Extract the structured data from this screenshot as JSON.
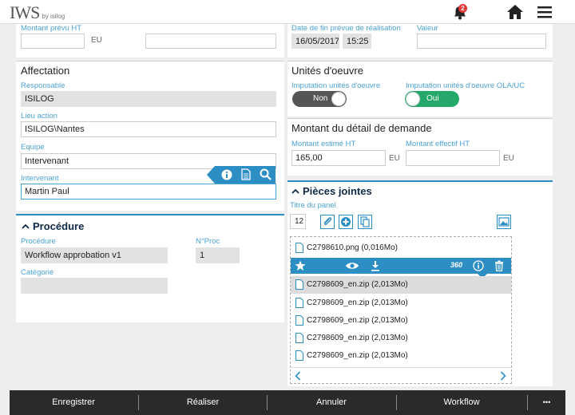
{
  "header": {
    "logo_main": "IWS",
    "logo_sub": "by isilog",
    "notification_count": "2"
  },
  "montant_prevu": {
    "label": "Montant prévu HT",
    "value": "",
    "unit": "EU"
  },
  "date_fin": {
    "label": "Date de fin prévue de réalisation",
    "date": "16/05/2017",
    "time": "15:25",
    "valeur_label": "Valeur",
    "valeur_value": ""
  },
  "affectation": {
    "title": "Affectation",
    "responsable_label": "Responsable",
    "responsable_value": "ISILOG",
    "lieu_label": "Lieu action",
    "lieu_value": "ISILOG\\Nantes",
    "equipe_label": "Equipe",
    "equipe_value": "Intervenant",
    "intervenant_label": "Intervenant",
    "intervenant_value": "Martin Paul"
  },
  "unites": {
    "title": "Unités d'oeuvre",
    "imputation_label": "Imputation unités d'oeuvre",
    "imputation_state": "Non",
    "imputation_ola_label": "Imputation unités d'oeuvre OLA/UC",
    "imputation_ola_state": "Oui",
    "colors": {
      "off": "#555555",
      "on": "#26a86a"
    }
  },
  "montant_detail": {
    "title": "Montant du détail de demande",
    "estime_label": "Montant estimé HT",
    "estime_value": "165,00",
    "estime_unit": "EU",
    "effectif_label": "Montant effectif HT",
    "effectif_value": "",
    "effectif_unit": "EU"
  },
  "procedure": {
    "title": "Procédure",
    "procedure_label": "Procédure",
    "procedure_value": "Workflow approbation v1",
    "nproc_label": "N°Proc",
    "nproc_value": "1",
    "categorie_label": "Catégorie",
    "categorie_value": ""
  },
  "pieces": {
    "title": "Pièces jointes",
    "titre_label": "Titre du panel",
    "count": "12",
    "files": [
      {
        "name": "C2798610.png (0,016Mo)",
        "selected": false
      },
      {
        "name": "C2798609_en.zip (2,013Mo)",
        "selected": true
      },
      {
        "name": "C2798609_en.zip (2,013Mo)",
        "selected": false
      },
      {
        "name": "C2798609_en.zip (2,013Mo)",
        "selected": false
      },
      {
        "name": "C2798609_en.zip (2,013Mo)",
        "selected": false
      },
      {
        "name": "C2798609_en.zip (2,013Mo)",
        "selected": false
      }
    ],
    "toolbar_360": "360"
  },
  "bottom": {
    "save": "Enregistrer",
    "realiser": "Réaliser",
    "annuler": "Annuler",
    "workflow": "Workflow",
    "more": "•••"
  },
  "colors": {
    "accent": "#2d8ec4",
    "label": "#4aa3d6",
    "bar": "#2a2a2a"
  }
}
